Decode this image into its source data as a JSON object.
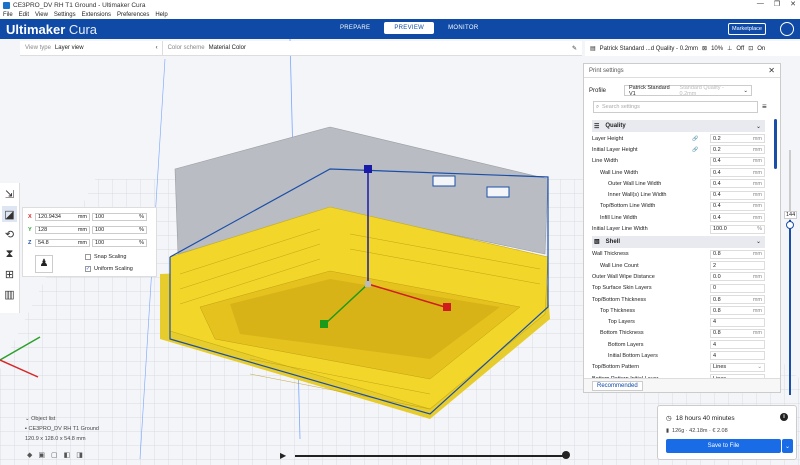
{
  "window": {
    "title": "CE3PRO_DV RH T1 Ground - Ultimaker Cura",
    "controls": [
      "—",
      "❐",
      "✕"
    ]
  },
  "menu": [
    "File",
    "Edit",
    "View",
    "Settings",
    "Extensions",
    "Preferences",
    "Help"
  ],
  "header": {
    "brand_bold": "Ultimaker",
    "brand_light": " Cura",
    "tabs": [
      "PREPARE",
      "PREVIEW",
      "MONITOR"
    ],
    "active_tab": "PREVIEW",
    "marketplace": "Marketplace",
    "brand_color": "#0e4aa6"
  },
  "viewbar": {
    "view_type_label": "View type",
    "view_type_value": "Layer view",
    "color_scheme_label": "Color scheme",
    "color_scheme_value": "Material Color"
  },
  "print_setup": {
    "profile_summary": "Patrick Standard ...d Quality - 0.2mm",
    "infill": "10%",
    "support": "Off",
    "adhesion": "On"
  },
  "scale_tool": {
    "x": "120.9434",
    "x_unit": "mm",
    "x_pct": "100",
    "pct": "%",
    "y": "128",
    "y_unit": "mm",
    "y_pct": "100",
    "z": "54.8",
    "z_unit": "mm",
    "z_pct": "100",
    "snap_label": "Snap Scaling",
    "uniform_label": "Uniform Scaling"
  },
  "settings_panel": {
    "title": "Print settings",
    "profile_label": "Profile",
    "profile_value": "Patrick Standard V1",
    "profile_hint": "Standard Quality - 0.2mm",
    "search_placeholder": "Search settings",
    "quality_label": "Quality",
    "shell_label": "Shell",
    "quality_rows": [
      {
        "label": "Layer Height",
        "value": "0.2",
        "unit": "mm"
      },
      {
        "label": "Initial Layer Height",
        "value": "0.2",
        "unit": "mm"
      },
      {
        "label": "Line Width",
        "value": "0.4",
        "unit": "mm"
      },
      {
        "label": "Wall Line Width",
        "value": "0.4",
        "unit": "mm"
      },
      {
        "label": "Outer Wall Line Width",
        "value": "0.4",
        "unit": "mm"
      },
      {
        "label": "Inner Wall(s) Line Width",
        "value": "0.4",
        "unit": "mm"
      },
      {
        "label": "Top/Bottom Line Width",
        "value": "0.4",
        "unit": "mm"
      },
      {
        "label": "Infill Line Width",
        "value": "0.4",
        "unit": "mm"
      },
      {
        "label": "Initial Layer Line Width",
        "value": "100.0",
        "unit": "%"
      }
    ],
    "shell_rows": [
      {
        "label": "Wall Thickness",
        "value": "0.8",
        "unit": "mm"
      },
      {
        "label": "Wall Line Count",
        "value": "2",
        "unit": ""
      },
      {
        "label": "Outer Wall Wipe Distance",
        "value": "0.0",
        "unit": "mm"
      },
      {
        "label": "Top Surface Skin Layers",
        "value": "0",
        "unit": ""
      },
      {
        "label": "Top/Bottom Thickness",
        "value": "0.8",
        "unit": "mm"
      },
      {
        "label": "Top Thickness",
        "value": "0.8",
        "unit": "mm"
      },
      {
        "label": "Top Layers",
        "value": "4",
        "unit": ""
      },
      {
        "label": "Bottom Thickness",
        "value": "0.8",
        "unit": "mm"
      },
      {
        "label": "Bottom Layers",
        "value": "4",
        "unit": ""
      },
      {
        "label": "Initial Bottom Layers",
        "value": "4",
        "unit": ""
      },
      {
        "label": "Top/Bottom Pattern",
        "value": "Lines",
        "unit": "⌄"
      },
      {
        "label": "Bottom Pattern Initial Layer",
        "value": "Lines",
        "unit": "⌄"
      }
    ],
    "recommended": "Recommended"
  },
  "layer_slider": {
    "value": "144"
  },
  "object_list": {
    "title": "Object list",
    "object_name": "CE3PRO_DV RH T1 Ground",
    "dimensions": "120.9 x 128.0 x 54.8 mm"
  },
  "action_panel": {
    "print_time": "18 hours 40 minutes",
    "material": "126g · 42.18m · € 2.08",
    "save_label": "Save to File"
  }
}
